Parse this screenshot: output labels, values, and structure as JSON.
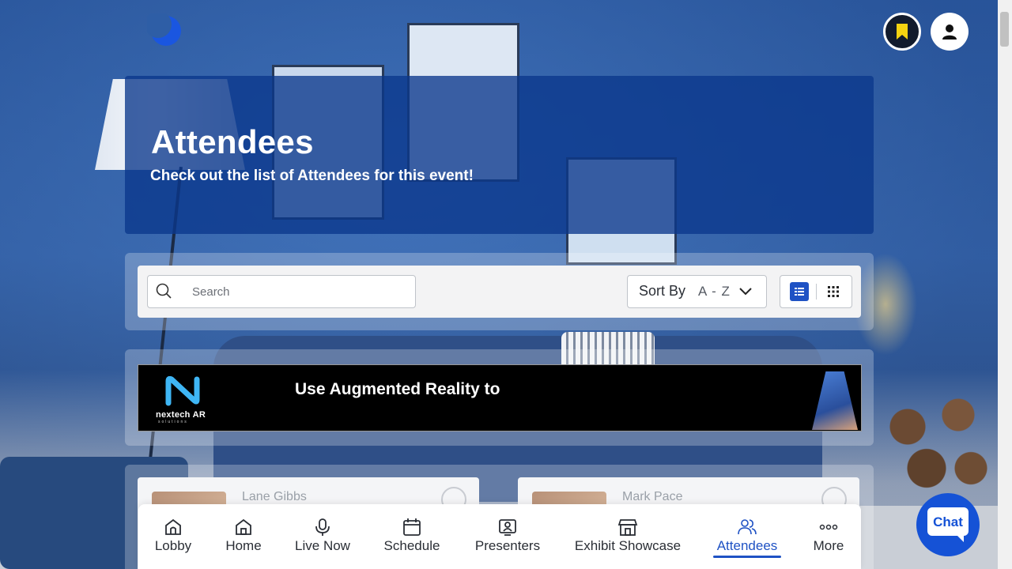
{
  "header": {
    "logo_icon": "moon-logo-icon",
    "bookmark_icon": "bookmark-icon",
    "profile_icon": "user-icon"
  },
  "hero": {
    "title": "Attendees",
    "subtitle": "Check out the list of Attendees for this event!"
  },
  "filters": {
    "search_placeholder": "Search",
    "sort_label": "Sort By",
    "sort_value": "A - Z",
    "view_modes": [
      "list",
      "grid"
    ],
    "active_view": "list"
  },
  "banner": {
    "brand": "nextech AR",
    "brand_sub": "solutions",
    "headline": "Use Augmented Reality to"
  },
  "attendees": [
    {
      "name": "Lane Gibbs"
    },
    {
      "name": "Mark Pace"
    }
  ],
  "nav": {
    "items": [
      {
        "label": "Lobby",
        "icon": "lobby-icon"
      },
      {
        "label": "Home",
        "icon": "home-icon"
      },
      {
        "label": "Live Now",
        "icon": "microphone-icon"
      },
      {
        "label": "Schedule",
        "icon": "calendar-icon"
      },
      {
        "label": "Presenters",
        "icon": "presenter-icon"
      },
      {
        "label": "Exhibit Showcase",
        "icon": "store-icon"
      },
      {
        "label": "Attendees",
        "icon": "users-icon"
      },
      {
        "label": "More",
        "icon": "more-icon"
      }
    ],
    "active": "Attendees"
  },
  "chat": {
    "label": "Chat"
  },
  "colors": {
    "accent": "#1f52c4",
    "hero_bg": "#0a378c",
    "chat_bg": "#1552d6"
  }
}
